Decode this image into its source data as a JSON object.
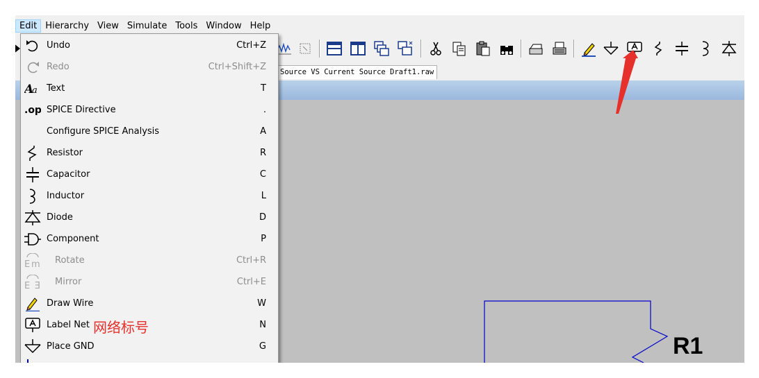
{
  "menubar": {
    "items": [
      "Edit",
      "Hierarchy",
      "View",
      "Simulate",
      "Tools",
      "Window",
      "Help"
    ],
    "active": "Edit"
  },
  "tab": {
    "label": "Source VS Current Source Draft1.raw"
  },
  "edit_menu": {
    "items": [
      {
        "id": "undo",
        "label": "Undo",
        "shortcut": "Ctrl+Z",
        "icon": "undo-icon",
        "enabled": true
      },
      {
        "id": "redo",
        "label": "Redo",
        "shortcut": "Ctrl+Shift+Z",
        "icon": "redo-icon",
        "enabled": false
      },
      {
        "id": "text",
        "label": "Text",
        "shortcut": "T",
        "icon": "text-icon",
        "enabled": true
      },
      {
        "id": "spice-directive",
        "label": "SPICE Directive",
        "shortcut": ".",
        "icon": "spice-directive-icon",
        "enabled": true
      },
      {
        "id": "configure-spice",
        "label": "Configure SPICE Analysis",
        "shortcut": "A",
        "icon": "",
        "enabled": true
      },
      {
        "id": "resistor",
        "label": "Resistor",
        "shortcut": "R",
        "icon": "resistor-icon",
        "enabled": true
      },
      {
        "id": "capacitor",
        "label": "Capacitor",
        "shortcut": "C",
        "icon": "capacitor-icon",
        "enabled": true
      },
      {
        "id": "inductor",
        "label": "Inductor",
        "shortcut": "L",
        "icon": "inductor-icon",
        "enabled": true
      },
      {
        "id": "diode",
        "label": "Diode",
        "shortcut": "D",
        "icon": "diode-icon",
        "enabled": true
      },
      {
        "id": "component",
        "label": "Component",
        "shortcut": "P",
        "icon": "component-icon",
        "enabled": true
      },
      {
        "id": "rotate",
        "label": "Rotate",
        "shortcut": "Ctrl+R",
        "icon": "rotate-icon",
        "enabled": false
      },
      {
        "id": "mirror",
        "label": "Mirror",
        "shortcut": "Ctrl+E",
        "icon": "mirror-icon",
        "enabled": false
      },
      {
        "id": "draw-wire",
        "label": "Draw Wire",
        "shortcut": "W",
        "icon": "pencil-icon",
        "enabled": true
      },
      {
        "id": "label-net",
        "label": "Label Net",
        "shortcut": "N",
        "icon": "label-net-icon",
        "enabled": true
      },
      {
        "id": "place-gnd",
        "label": "Place GND",
        "shortcut": "G",
        "icon": "ground-icon",
        "enabled": true
      }
    ],
    "annotation": "网络标号"
  },
  "schematic": {
    "component_label": "R1"
  },
  "colors": {
    "annotation": "#e5302c",
    "wire": "#0000cc",
    "canvas": "#c0c0c0",
    "menu_highlight": "#cce8ff"
  }
}
